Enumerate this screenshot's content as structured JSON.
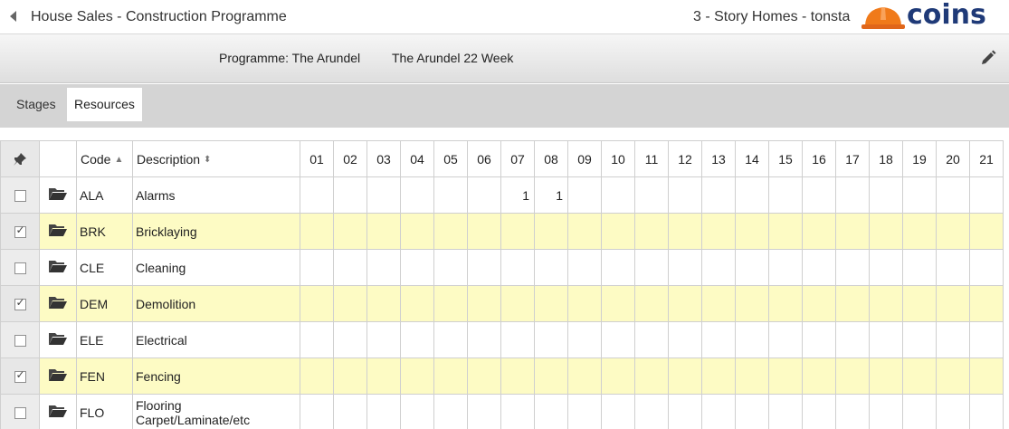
{
  "header": {
    "title": "House Sales - Construction Programme",
    "company": "3 - Story Homes - tonsta",
    "logo_text": "COINS"
  },
  "programme": {
    "label": "Programme: The Arundel",
    "name": "The Arundel 22 Week"
  },
  "tabs": [
    {
      "label": "Stages",
      "active": false
    },
    {
      "label": "Resources",
      "active": true
    }
  ],
  "grid": {
    "columns": {
      "code": "Code",
      "description": "Description",
      "weeks": [
        "01",
        "02",
        "03",
        "04",
        "05",
        "06",
        "07",
        "08",
        "09",
        "10",
        "11",
        "12",
        "13",
        "14",
        "15",
        "16",
        "17",
        "18",
        "19",
        "20",
        "21"
      ]
    },
    "rows": [
      {
        "code": "ALA",
        "description": "Alarms",
        "checked": false,
        "values": [
          "",
          "",
          "",
          "",
          "",
          "",
          "1",
          "1",
          "",
          "",
          "",
          "",
          "",
          "",
          "",
          "",
          "",
          "",
          "",
          "",
          ""
        ]
      },
      {
        "code": "BRK",
        "description": "Bricklaying",
        "checked": true,
        "values": [
          "",
          "",
          "",
          "",
          "",
          "",
          "",
          "",
          "",
          "",
          "",
          "",
          "",
          "",
          "",
          "",
          "",
          "",
          "",
          "",
          ""
        ]
      },
      {
        "code": "CLE",
        "description": "Cleaning",
        "checked": false,
        "values": [
          "",
          "",
          "",
          "",
          "",
          "",
          "",
          "",
          "",
          "",
          "",
          "",
          "",
          "",
          "",
          "",
          "",
          "",
          "",
          "",
          ""
        ]
      },
      {
        "code": "DEM",
        "description": "Demolition",
        "checked": true,
        "values": [
          "",
          "",
          "",
          "",
          "",
          "",
          "",
          "",
          "",
          "",
          "",
          "",
          "",
          "",
          "",
          "",
          "",
          "",
          "",
          "",
          ""
        ]
      },
      {
        "code": "ELE",
        "description": "Electrical",
        "checked": false,
        "values": [
          "",
          "",
          "",
          "",
          "",
          "",
          "",
          "",
          "",
          "",
          "",
          "",
          "",
          "",
          "",
          "",
          "",
          "",
          "",
          "",
          ""
        ]
      },
      {
        "code": "FEN",
        "description": "Fencing",
        "checked": true,
        "values": [
          "",
          "",
          "",
          "",
          "",
          "",
          "",
          "",
          "",
          "",
          "",
          "",
          "",
          "",
          "",
          "",
          "",
          "",
          "",
          "",
          ""
        ]
      },
      {
        "code": "FLO",
        "description": "Flooring",
        "description_line2": "Carpet/Laminate/etc",
        "checked": false,
        "values": [
          "",
          "",
          "",
          "",
          "",
          "",
          "",
          "",
          "",
          "",
          "",
          "",
          "",
          "",
          "",
          "",
          "",
          "",
          "",
          "",
          ""
        ]
      }
    ],
    "checked_mark": "✓",
    "icons": {
      "pin": "pin-icon",
      "folder": "folder-icon",
      "sort_asc": "▲",
      "sort_both": "⬍"
    }
  },
  "colors": {
    "selected_row": "#fdfbc4",
    "logo_orange": "#f07a1a",
    "logo_blue": "#1f3a78"
  }
}
